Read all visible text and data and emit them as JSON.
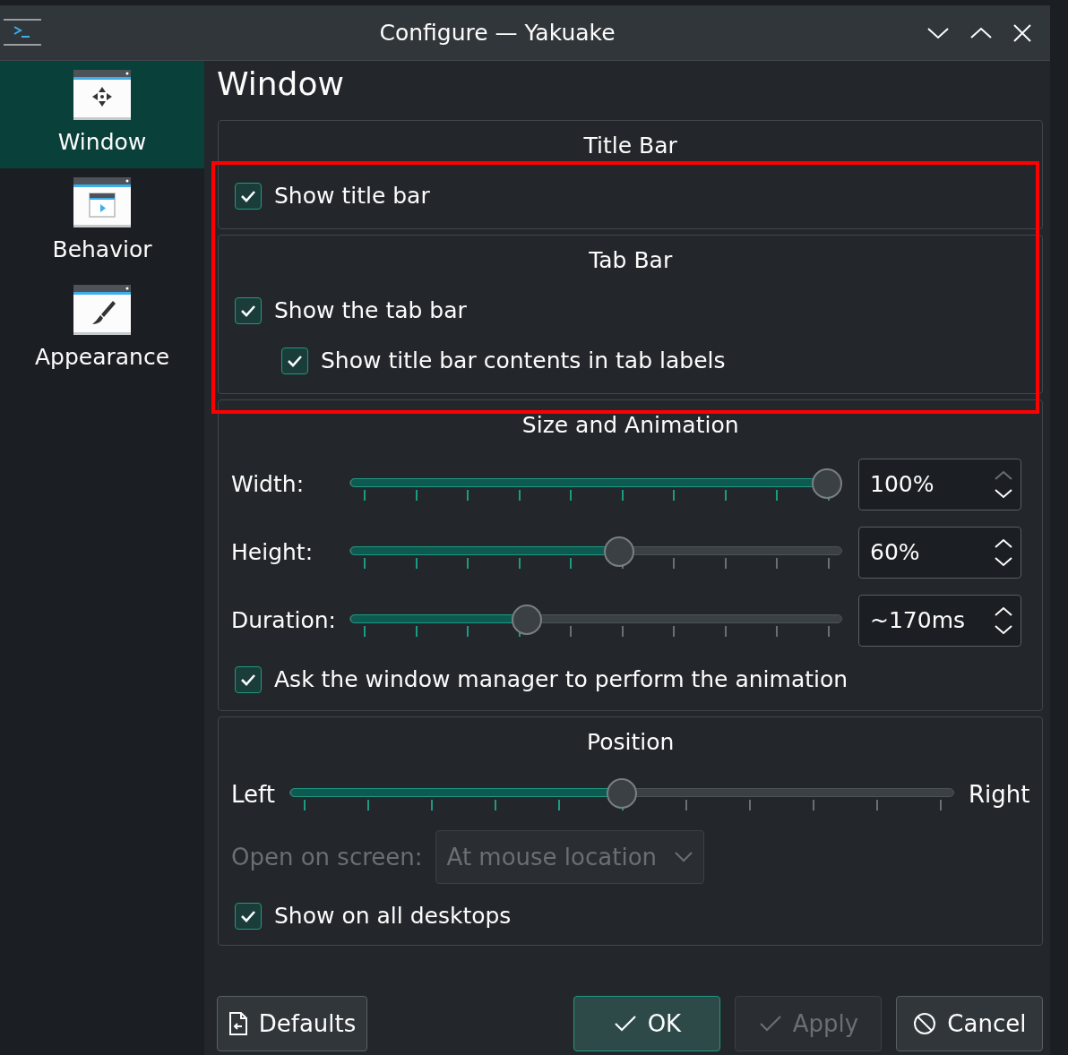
{
  "window": {
    "title": "Configure — Yakuake"
  },
  "sidebar": {
    "items": [
      {
        "label": "Window",
        "selected": true
      },
      {
        "label": "Behavior",
        "selected": false
      },
      {
        "label": "Appearance",
        "selected": false
      }
    ]
  },
  "page_title": "Window",
  "groups": [
    {
      "title": "Title Bar",
      "items": [
        {
          "kind": "checkbox",
          "label": "Show title bar",
          "checked": true,
          "indented": false
        }
      ]
    },
    {
      "title": "Tab Bar",
      "items": [
        {
          "kind": "checkbox",
          "label": "Show the tab bar",
          "checked": true,
          "indented": false
        },
        {
          "kind": "checkbox",
          "label": "Show title bar contents in tab labels",
          "checked": true,
          "indented": true
        }
      ]
    },
    {
      "title": "Size and Animation",
      "items": [
        {
          "kind": "slider",
          "label": "Width:",
          "level": 1.0,
          "value": "100%",
          "up_enabled": false
        },
        {
          "kind": "slider",
          "label": "Height:",
          "level": 0.55,
          "value": "60%",
          "up_enabled": true
        },
        {
          "kind": "slider",
          "label": "Duration:",
          "level": 0.35,
          "value": "~170ms",
          "up_enabled": true
        },
        {
          "kind": "checkbox",
          "label": "Ask the window manager to perform the animation",
          "checked": true,
          "indented": false
        }
      ]
    },
    {
      "title": "Position",
      "items": [
        {
          "kind": "range",
          "left": "Left",
          "right": "Right",
          "level": 0.5
        },
        {
          "kind": "select",
          "label": "Open on screen:",
          "value": "At mouse location",
          "disabled": true
        },
        {
          "kind": "checkbox",
          "label": "Show on all desktops",
          "checked": true,
          "indented": false
        }
      ]
    }
  ],
  "buttons": [
    {
      "label": "Defaults",
      "kind": "defaults",
      "default": false,
      "disabled": false
    },
    {
      "label": "OK",
      "kind": "confirm",
      "default": true,
      "disabled": false
    },
    {
      "label": "Apply",
      "kind": "confirm",
      "default": false,
      "disabled": true
    },
    {
      "label": "Cancel",
      "kind": "cancel",
      "default": false,
      "disabled": false
    }
  ]
}
